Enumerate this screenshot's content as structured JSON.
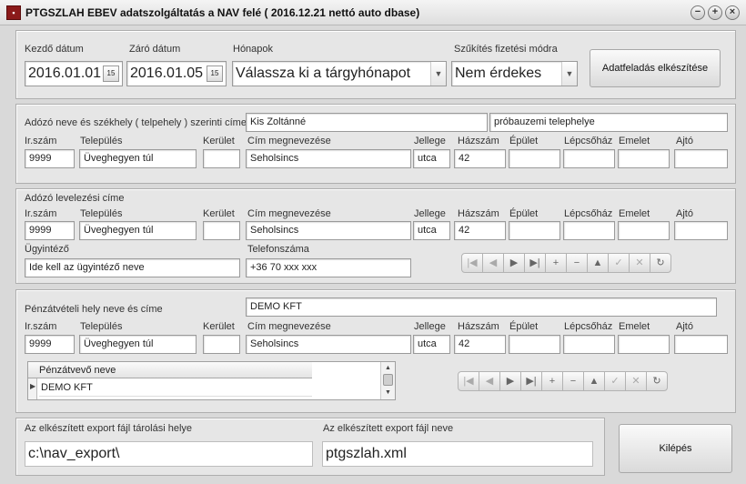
{
  "window": {
    "title": "PTGSZLAH EBEV adatszolgáltatás a NAV felé ( 2016.12.21 nettó auto dbase)",
    "controls": [
      "−",
      "+",
      "×"
    ]
  },
  "period": {
    "start_label": "Kezdő dátum",
    "start_value": "2016.01.01",
    "end_label": "Záró dátum",
    "end_value": "2016.01.05",
    "months_label": "Hónapok",
    "months_value": "Válassza ki a tárgyhónapot",
    "payment_label": "Szűkítés fizetési módra",
    "payment_value": "Nem érdekes",
    "generate_button": "Adatfeladás elkészítése"
  },
  "address_labels": {
    "zip": "Ir.szám",
    "city": "Település",
    "district": "Kerület",
    "street": "Cím megnevezése",
    "type": "Jellege",
    "number": "Házszám",
    "building": "Épület",
    "staircase": "Lépcsőház",
    "floor": "Emelet",
    "door": "Ajtó"
  },
  "taxpayer": {
    "label": "Adózó neve és székhely ( telpehely ) szerinti címe",
    "name": "Kis Zoltánné",
    "site": "próbauzemi telephelye",
    "zip": "9999",
    "city": "Üveghegyen túl",
    "district": "",
    "street": "Seholsincs",
    "type": "utca",
    "number": "42",
    "building": "",
    "staircase": "",
    "floor": "",
    "door": ""
  },
  "mailing": {
    "label": "Adózó levelezési címe",
    "zip": "9999",
    "city": "Üveghegyen túl",
    "district": "",
    "street": "Seholsincs",
    "type": "utca",
    "number": "42",
    "building": "",
    "staircase": "",
    "floor": "",
    "door": "",
    "admin_label": "Ügyintéző",
    "admin_value": "Ide kell az ügyintéző neve",
    "phone_label": "Telefonszáma",
    "phone_value": "+36 70 xxx xxx"
  },
  "navigator_icons": [
    "first-icon",
    "prior-icon",
    "next-icon",
    "last-icon",
    "insert-icon",
    "delete-icon",
    "edit-icon",
    "post-icon",
    "cancel-icon",
    "refresh-icon"
  ],
  "exchange": {
    "label": "Pénzátvételi hely neve és címe",
    "name": "DEMO KFT",
    "zip": "9999",
    "city": "Üveghegyen túl",
    "district": "",
    "street": "Seholsincs",
    "type": "utca",
    "number": "42",
    "building": "",
    "staircase": "",
    "floor": "",
    "door": "",
    "grid_header": "Pénzátvevő neve",
    "grid_rows": [
      "DEMO KFT"
    ]
  },
  "export": {
    "path_label": "Az elkészített export fájl tárolási helye",
    "path_value": "c:\\nav_export\\",
    "file_label": "Az elkészített export fájl neve",
    "file_value": "ptgszlah.xml",
    "exit_button": "Kilépés"
  }
}
